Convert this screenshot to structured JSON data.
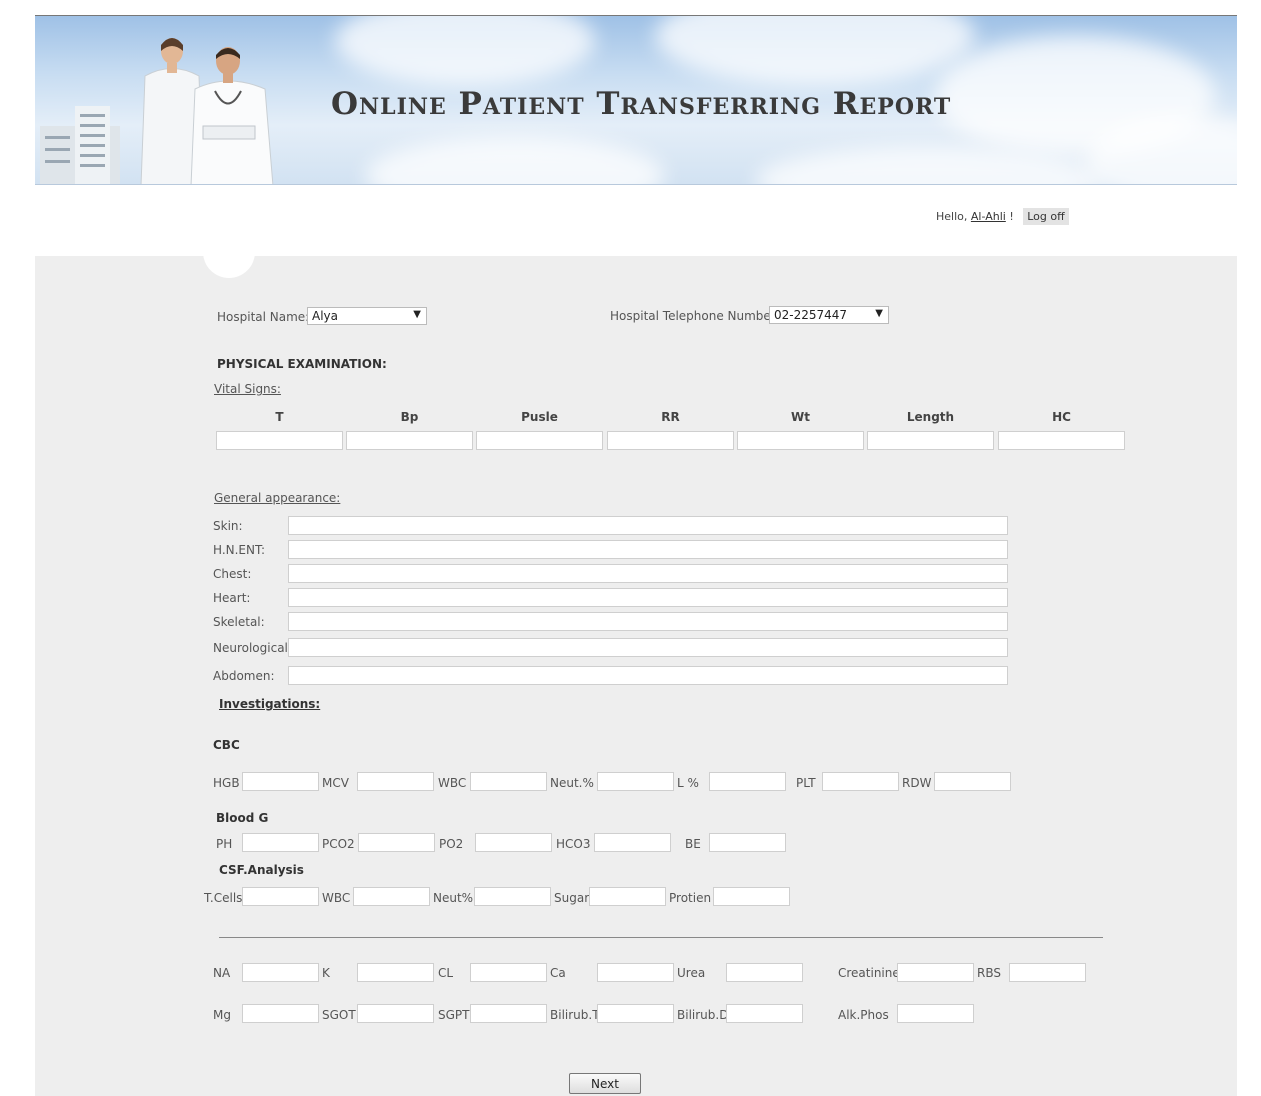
{
  "header": {
    "title": "Online Patient Transferring Report"
  },
  "user": {
    "greeting": "Hello,",
    "name": "Al-Ahli",
    "exclaim": "!",
    "logoff_label": "Log off"
  },
  "hospital": {
    "name_label": "Hospital Name:",
    "name_value": "Alya",
    "phone_label": "Hospital Telephone Number:",
    "phone_value": "02-2257447"
  },
  "physical": {
    "heading": "PHYSICAL EXAMINATION:",
    "vital_label": "Vital Signs:",
    "vital_columns": [
      "T",
      "Bp",
      "Pusle",
      "RR",
      "Wt",
      "Length",
      "HC"
    ],
    "general_label": "General appearance:",
    "general_fields": [
      "Skin:",
      "H.N.ENT:",
      "Chest:",
      "Heart:",
      "Skeletal:",
      "Neurological:",
      "Abdomen:"
    ]
  },
  "investigations": {
    "heading": "Investigations:",
    "cbc": {
      "heading": "CBC",
      "fields": [
        "HGB",
        "MCV",
        "WBC",
        "Neut.%",
        "L %",
        "PLT",
        "RDW"
      ]
    },
    "blood_g": {
      "heading": "Blood G",
      "fields": [
        "PH",
        "PCO2",
        "PO2",
        "HCO3",
        "BE"
      ]
    },
    "csf": {
      "heading": "CSF.Analysis",
      "fields": [
        "T.Cells",
        "WBC",
        "Neut%",
        "Sugar",
        "Protien"
      ]
    },
    "chem1": [
      "NA",
      "K",
      "CL",
      "Ca",
      "Urea",
      "Creatinine",
      "RBS"
    ],
    "chem2": [
      "Mg",
      "SGOT",
      "SGPT",
      "Bilirub.T",
      "Bilirub.D",
      "Alk.Phos"
    ]
  },
  "actions": {
    "next_label": "Next"
  }
}
